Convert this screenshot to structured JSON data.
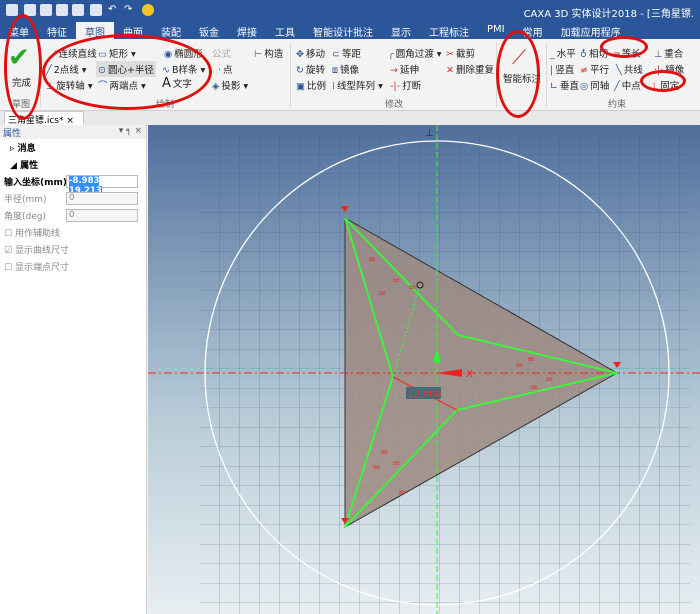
{
  "window": {
    "title": "CAXA 3D 实体设计2018 - [三角星镖."
  },
  "tabs": [
    "菜单",
    "特征",
    "草图",
    "曲面",
    "装配",
    "钣金",
    "焊接",
    "工具",
    "智能设计批注",
    "显示",
    "工程标注",
    "PMI",
    "常用",
    "加载应用程序"
  ],
  "ribbon": {
    "finish": "完成",
    "sketch_group": "草图",
    "draw": [
      "连续直线",
      "矩形",
      "椭圆形",
      "公式",
      "构造",
      "2点线",
      "圆心+半径",
      "B样条",
      "点",
      "旋转轴",
      "两端点",
      "文字",
      "投影"
    ],
    "draw_group": "绘制",
    "modify": [
      "移动",
      "等距",
      "圆角过渡",
      "截剪",
      "旋转",
      "镜像",
      "延伸",
      "删除重复",
      "比例",
      "线型阵列",
      "打断"
    ],
    "modify_group": "修改",
    "smart_dim": "智能标注",
    "constraints": [
      "水平",
      "相切",
      "等长",
      "重合",
      "竖直",
      "平行",
      "共线",
      "镜像",
      "垂直",
      "同轴",
      "中点",
      "固定"
    ],
    "constraint_group": "约束"
  },
  "doc_tab": "三角星镖.ics*",
  "panel": {
    "title": "属性",
    "sec1": "消息",
    "sec2": "属性",
    "coord_label": "输入坐标(mm)",
    "coord_value": "-8.983 19.213",
    "radius_label": "半径(mm)",
    "radius_value": "0",
    "angle_label": "角度(deg)",
    "angle_value": "0",
    "cb1": "用作辅助线",
    "cb2": "显示曲线尺寸",
    "cb3": "显示端点尺寸"
  },
  "canvas": {
    "dimension": "12.000",
    "axis_x": "X"
  }
}
